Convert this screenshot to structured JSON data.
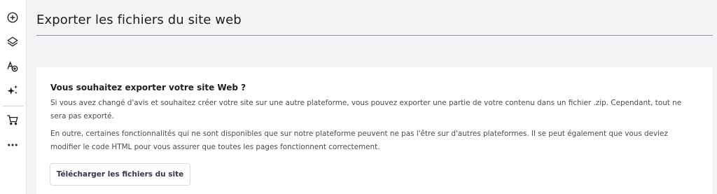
{
  "sidebar": {
    "icons": [
      "add-circle-icon",
      "layers-icon",
      "text-palette-icon",
      "ai-sparkles-icon",
      "shopping-cart-icon",
      "more-dots-icon"
    ]
  },
  "page": {
    "title": "Exporter les fichiers du site web"
  },
  "card": {
    "heading": "Vous souhaitez exporter votre site Web ?",
    "paragraph1": "Si vous avez changé d'avis et souhaitez créer votre site sur une autre plateforme, vous pouvez exporter une partie de votre contenu dans un fichier .zip. Cependant, tout ne sera pas exporté.",
    "paragraph2": "En outre, certaines fonctionnalités qui ne sont disponibles que sur notre plateforme peuvent ne pas l'être sur d'autres plateformes. Il se peut également que vous deviez modifier le code HTML pour vous assurer que toutes les pages fonctionnent correctement.",
    "button_label": "Télécharger les fichiers du site"
  },
  "colors": {
    "background": "#f4f4f6",
    "card": "#ffffff",
    "title_text": "#1d1e20",
    "body_text": "#4a4a55",
    "icon": "#1d1e20"
  }
}
